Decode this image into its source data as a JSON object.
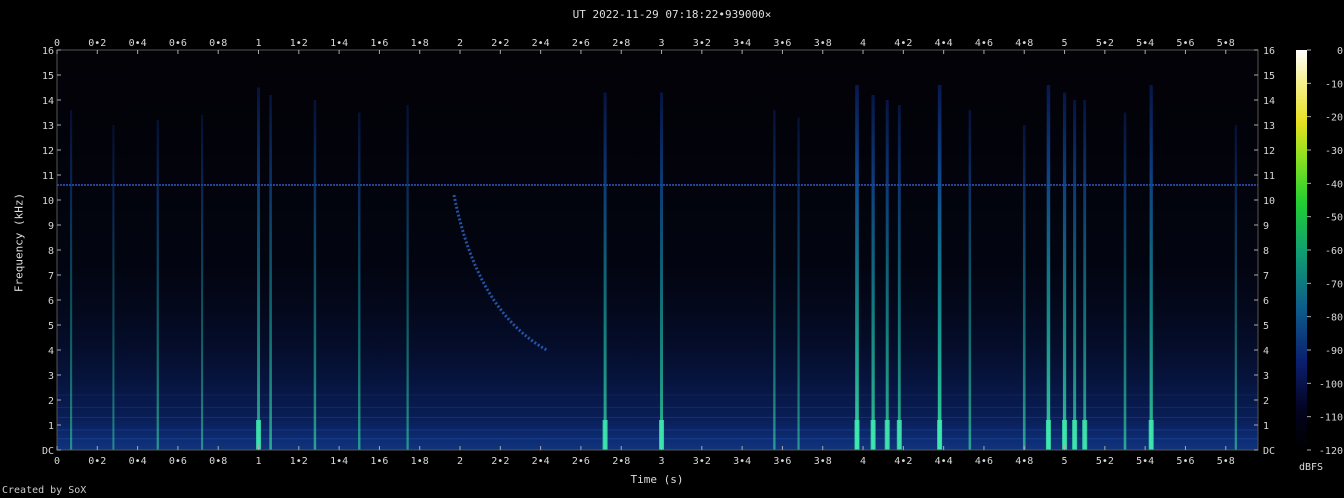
{
  "title": "UT 2022-11-29 07:18:22•939000×",
  "credit": "Created by SoX",
  "chart_data": {
    "type": "heatmap",
    "title": "UT 2022-11-29 07:18:22•939000×",
    "xlabel": "Time (s)",
    "ylabel": "Frequency (kHz)",
    "xlim": [
      0,
      5.96
    ],
    "ylim": [
      0,
      16
    ],
    "x_ticks": [
      "0",
      "0•2",
      "0•4",
      "0•6",
      "0•8",
      "1",
      "1•2",
      "1•4",
      "1•6",
      "1•8",
      "2",
      "2•2",
      "2•4",
      "2•6",
      "2•8",
      "3",
      "3•2",
      "3•4",
      "3•6",
      "3•8",
      "4",
      "4•2",
      "4•4",
      "4•6",
      "4•8",
      "5",
      "5•2",
      "5•4",
      "5•6",
      "5•8"
    ],
    "y_ticks": [
      "DC",
      "1",
      "2",
      "3",
      "4",
      "5",
      "6",
      "7",
      "8",
      "9",
      "10",
      "11",
      "12",
      "13",
      "14",
      "15",
      "16"
    ],
    "colorbar": {
      "label": "dBFS",
      "ticks": [
        "0",
        "-10",
        "-20",
        "-30",
        "-40",
        "-50",
        "-60",
        "-70",
        "-80",
        "-90",
        "-100",
        "-110",
        "-120"
      ],
      "range": [
        -120,
        0
      ]
    },
    "features": {
      "tone_khz": 10.6,
      "impulses": [
        {
          "t": 0.07,
          "fmax": 13.6,
          "level": 0.25
        },
        {
          "t": 0.28,
          "fmax": 13.0,
          "level": 0.2
        },
        {
          "t": 0.5,
          "fmax": 13.2,
          "level": 0.3
        },
        {
          "t": 0.72,
          "fmax": 13.4,
          "level": 0.25
        },
        {
          "t": 1.0,
          "fmax": 14.5,
          "level": 0.55
        },
        {
          "t": 1.06,
          "fmax": 14.2,
          "level": 0.45
        },
        {
          "t": 1.28,
          "fmax": 14.0,
          "level": 0.4
        },
        {
          "t": 1.5,
          "fmax": 13.5,
          "level": 0.35
        },
        {
          "t": 1.74,
          "fmax": 13.8,
          "level": 0.3
        },
        {
          "t": 2.72,
          "fmax": 14.3,
          "level": 0.6
        },
        {
          "t": 3.0,
          "fmax": 14.3,
          "level": 0.6
        },
        {
          "t": 3.56,
          "fmax": 13.6,
          "level": 0.35
        },
        {
          "t": 3.68,
          "fmax": 13.3,
          "level": 0.3
        },
        {
          "t": 3.97,
          "fmax": 14.6,
          "level": 0.85
        },
        {
          "t": 4.05,
          "fmax": 14.2,
          "level": 0.7
        },
        {
          "t": 4.12,
          "fmax": 14.0,
          "level": 0.6
        },
        {
          "t": 4.18,
          "fmax": 13.8,
          "level": 0.55
        },
        {
          "t": 4.38,
          "fmax": 14.6,
          "level": 0.85
        },
        {
          "t": 4.53,
          "fmax": 13.6,
          "level": 0.4
        },
        {
          "t": 4.8,
          "fmax": 13.0,
          "level": 0.45
        },
        {
          "t": 4.92,
          "fmax": 14.6,
          "level": 0.8
        },
        {
          "t": 5.0,
          "fmax": 14.3,
          "level": 0.7
        },
        {
          "t": 5.05,
          "fmax": 14.0,
          "level": 0.6
        },
        {
          "t": 5.1,
          "fmax": 14.0,
          "level": 0.55
        },
        {
          "t": 5.3,
          "fmax": 13.5,
          "level": 0.45
        },
        {
          "t": 5.43,
          "fmax": 14.6,
          "level": 0.7
        },
        {
          "t": 5.85,
          "fmax": 13.0,
          "level": 0.3
        }
      ],
      "chirp": {
        "t_start": 1.97,
        "f_start": 10.2,
        "t_end": 2.43,
        "f_end": 4.0
      }
    }
  }
}
